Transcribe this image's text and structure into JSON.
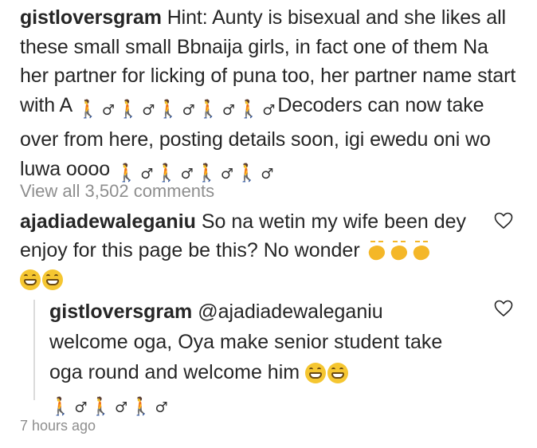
{
  "caption": {
    "username": "gistloversgram",
    "text_part1": "Hint: Aunty is bisexual and she likes all these small small Bbnaija girls, in fact one of them Na her partner for licking of puna too, her partner name start with A",
    "text_part2": "Decoders can now take over from here, posting details soon, igi ewedu oni wo luwa oooo"
  },
  "view_all_comments": "View all 3,502 comments",
  "comment": {
    "username": "ajadiadewaleganiu",
    "text": "So na wetin my wife been dey enjoy for this page be this? No wonder"
  },
  "reply": {
    "username": "gistloversgram",
    "mention": "@ajadiadewaleganiu",
    "text": "welcome oga, Oya make senior student take oga round and welcome him"
  },
  "timestamp": "7 hours ago",
  "emoji": {
    "walker": "🚶",
    "male": "♂"
  },
  "icons": [
    "heart-icon",
    "walking-man-emoji",
    "male-sign",
    "grinning-face-emoji",
    "clapping-hands-emoji"
  ]
}
